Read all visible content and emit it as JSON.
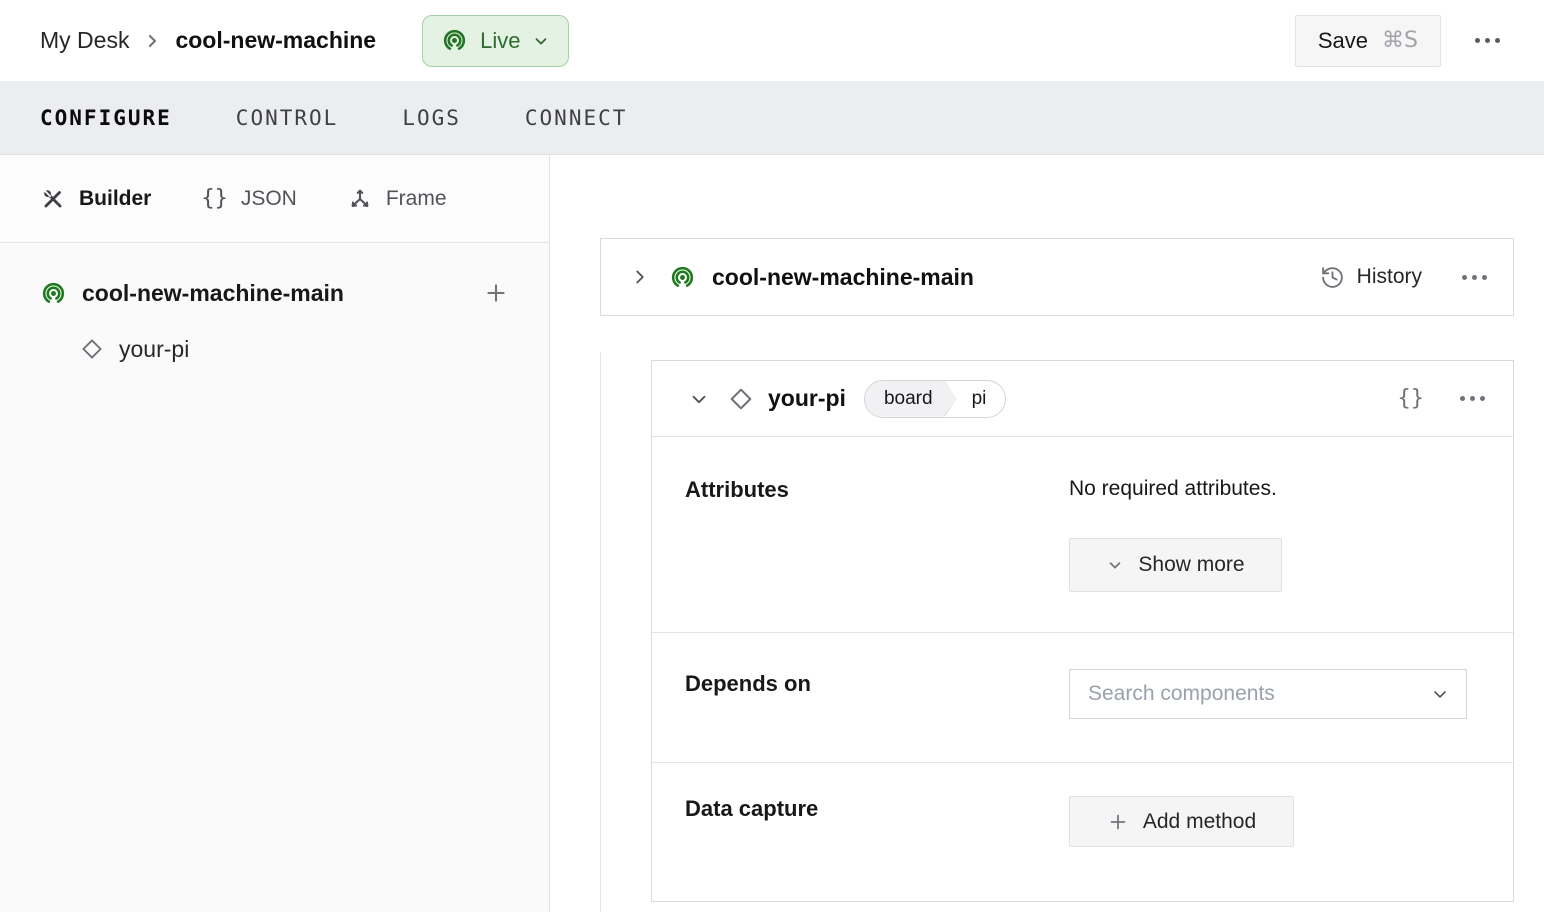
{
  "header": {
    "breadcrumb": {
      "parent": "My Desk",
      "current": "cool-new-machine"
    },
    "status_badge": {
      "label": "Live"
    },
    "save_button": {
      "label": "Save",
      "shortcut": "⌘S"
    }
  },
  "tabs": [
    {
      "label": "CONFIGURE",
      "active": true
    },
    {
      "label": "CONTROL",
      "active": false
    },
    {
      "label": "LOGS",
      "active": false
    },
    {
      "label": "CONNECT",
      "active": false
    }
  ],
  "sidebar": {
    "modes": [
      {
        "label": "Builder",
        "icon": "tools-icon",
        "active": true
      },
      {
        "label": "JSON",
        "icon": "braces-icon",
        "active": false
      },
      {
        "label": "Frame",
        "icon": "axes-icon",
        "active": false
      }
    ],
    "tree": {
      "part_name": "cool-new-machine-main",
      "components": [
        {
          "name": "your-pi"
        }
      ]
    }
  },
  "main": {
    "part_card": {
      "title": "cool-new-machine-main",
      "history_label": "History"
    },
    "component_card": {
      "title": "your-pi",
      "type_badge": {
        "type": "board",
        "model": "pi"
      },
      "attributes": {
        "label": "Attributes",
        "empty_text": "No required attributes.",
        "show_more_label": "Show more"
      },
      "depends_on": {
        "label": "Depends on",
        "placeholder": "Search components"
      },
      "data_capture": {
        "label": "Data capture",
        "add_method_label": "Add method"
      }
    }
  },
  "colors": {
    "accent_green": "#1f7a1f",
    "live_badge_bg": "#e3f2e3",
    "live_badge_border": "#a5d2a5",
    "live_badge_text": "#2f6b2f",
    "tabbar_bg": "#ecedf0",
    "sidebar_bg": "#fafafa",
    "card_border": "#d9d9de",
    "button_bg": "#f5f5f6"
  }
}
